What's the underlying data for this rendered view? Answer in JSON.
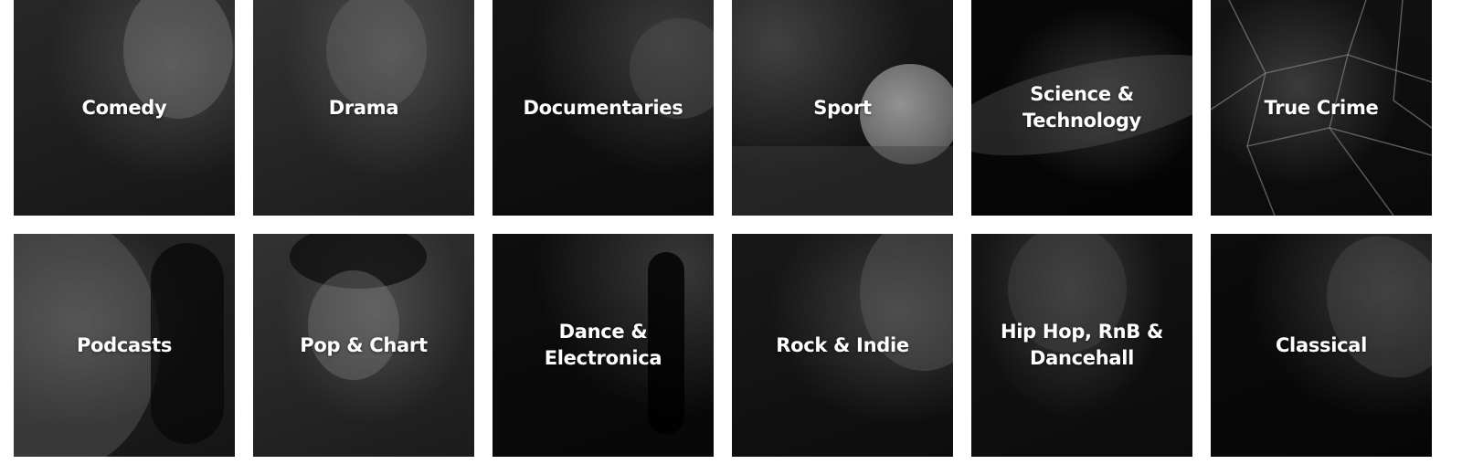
{
  "categories": [
    {
      "label": "Comedy"
    },
    {
      "label": "Drama"
    },
    {
      "label": "Documentaries"
    },
    {
      "label": "Sport"
    },
    {
      "label": "Science &\nTechnology"
    },
    {
      "label": "True Crime"
    },
    {
      "label": "Podcasts"
    },
    {
      "label": "Pop & Chart"
    },
    {
      "label": "Dance &\nElectronica"
    },
    {
      "label": "Rock & Indie"
    },
    {
      "label": "Hip Hop, RnB &\nDancehall"
    },
    {
      "label": "Classical"
    }
  ]
}
